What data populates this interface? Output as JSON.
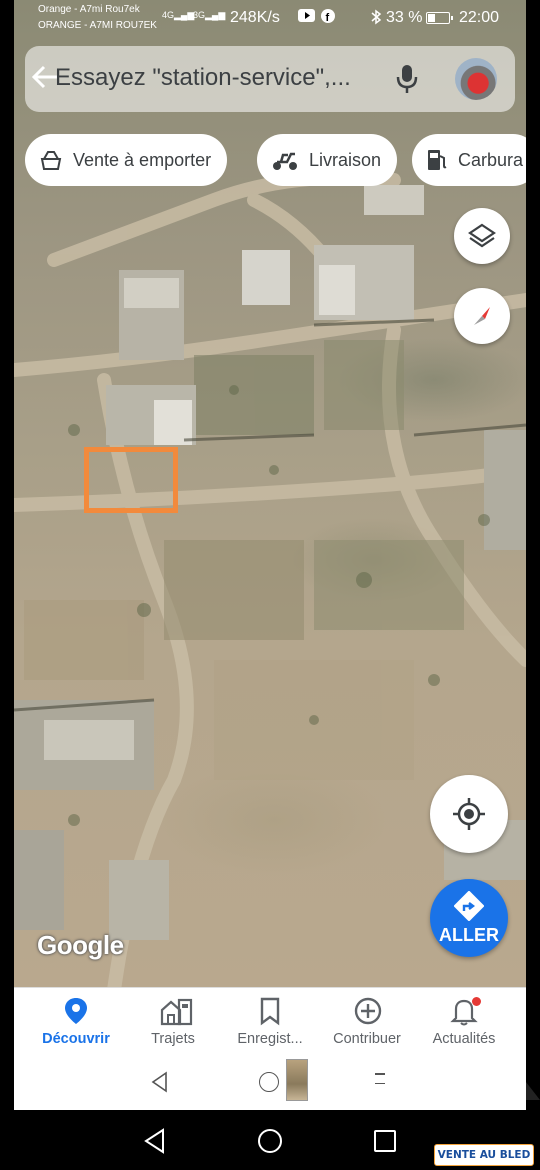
{
  "status_bar": {
    "carrier_line1": "Orange - A7mi Rou7ek",
    "carrier_line2": "ORANGE - A7MI ROU7EK",
    "signal1_type": "4G",
    "signal2_type": "3G",
    "net_speed": "248K/s",
    "battery_percent": "33 %",
    "battery_level": 0.33,
    "time": "22:00",
    "icons": [
      "youtube-icon",
      "facebook-icon",
      "bluetooth-icon"
    ]
  },
  "search": {
    "placeholder": "Essayez \"station-service\",..."
  },
  "chips": [
    {
      "label": "Vente à emporter",
      "icon": "takeout-bag-icon"
    },
    {
      "label": "Livraison",
      "icon": "delivery-scooter-icon"
    },
    {
      "label": "Carbura",
      "icon": "gas-station-icon"
    }
  ],
  "map": {
    "attribution": "Google",
    "go_button_label": "ALLER",
    "layers_icon": "layers-icon",
    "compass_icon": "compass-icon",
    "locate_icon": "my-location-icon",
    "marker_color": "#f28a3c"
  },
  "bottom_nav": [
    {
      "label": "Découvrir",
      "icon": "location-pin-icon",
      "active": true
    },
    {
      "label": "Trajets",
      "icon": "commute-icon",
      "active": false
    },
    {
      "label": "Enregist...",
      "icon": "bookmark-icon",
      "active": false
    },
    {
      "label": "Contribuer",
      "icon": "add-circle-icon",
      "active": false
    },
    {
      "label": "Actualités",
      "icon": "bell-icon",
      "active": false
    }
  ],
  "colors": {
    "accent": "#1a73e8",
    "notification": "#e53935"
  },
  "watermark": {
    "text": "VENTE AU BLED"
  }
}
